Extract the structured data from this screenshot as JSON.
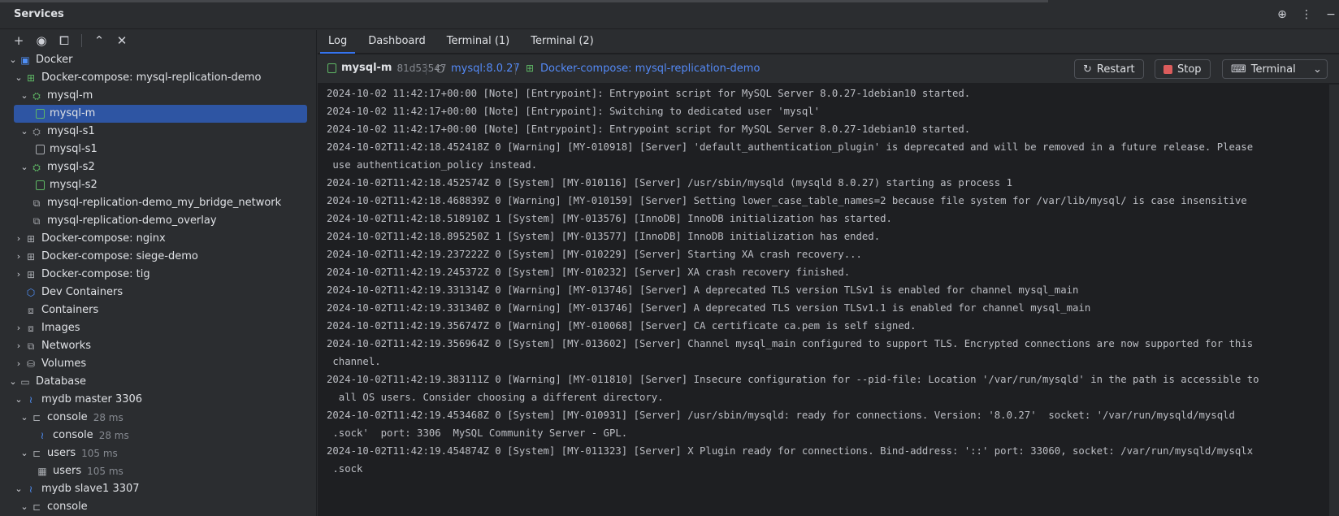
{
  "header": {
    "title": "Services"
  },
  "tree": [
    {
      "label": "Docker",
      "indent": 0,
      "chevron": "v",
      "icon": "docker-icon",
      "glyph": "▣",
      "cls": "docker",
      "meta": ""
    },
    {
      "label": "Docker-compose: mysql-replication-demo",
      "indent": 1,
      "chevron": "v",
      "icon": "compose-icon",
      "glyph": "⊞",
      "cls": "compose",
      "meta": ""
    },
    {
      "label": "mysql-m",
      "indent": 2,
      "chevron": "v",
      "icon": "service-icon",
      "glyph": "⛭",
      "cls": "svc",
      "meta": ""
    },
    {
      "label": "mysql-m",
      "indent": 3,
      "chevron": "",
      "icon": "container-running-icon",
      "glyph": "",
      "cls": "cont",
      "meta": "",
      "selected": true
    },
    {
      "label": "mysql-s1",
      "indent": 2,
      "chevron": "v",
      "icon": "service-icon",
      "glyph": "⛭",
      "cls": "svcg",
      "meta": ""
    },
    {
      "label": "mysql-s1",
      "indent": 3,
      "chevron": "",
      "icon": "container-stopped-icon",
      "glyph": "",
      "cls": "conto",
      "meta": ""
    },
    {
      "label": "mysql-s2",
      "indent": 2,
      "chevron": "v",
      "icon": "service-icon",
      "glyph": "⛭",
      "cls": "svc",
      "meta": ""
    },
    {
      "label": "mysql-s2",
      "indent": 3,
      "chevron": "",
      "icon": "container-running-icon",
      "glyph": "",
      "cls": "cont",
      "meta": ""
    },
    {
      "label": "mysql-replication-demo_my_bridge_network",
      "indent": 2,
      "chevron": "",
      "icon": "network-icon",
      "glyph": "⧉",
      "cls": "grey",
      "meta": ""
    },
    {
      "label": "mysql-replication-demo_overlay",
      "indent": 2,
      "chevron": "",
      "icon": "network-icon",
      "glyph": "⧉",
      "cls": "grey",
      "meta": ""
    },
    {
      "label": "Docker-compose: nginx",
      "indent": 1,
      "chevron": ">",
      "icon": "compose-icon",
      "glyph": "⊞",
      "cls": "grey",
      "meta": ""
    },
    {
      "label": "Docker-compose: siege-demo",
      "indent": 1,
      "chevron": ">",
      "icon": "compose-icon",
      "glyph": "⊞",
      "cls": "grey",
      "meta": ""
    },
    {
      "label": "Docker-compose: tig",
      "indent": 1,
      "chevron": ">",
      "icon": "compose-icon",
      "glyph": "⊞",
      "cls": "grey",
      "meta": ""
    },
    {
      "label": "Dev Containers",
      "indent": 1,
      "chevron": "",
      "icon": "dev-containers-icon",
      "glyph": "⬡",
      "cls": "blue",
      "meta": ""
    },
    {
      "label": "Containers",
      "indent": 1,
      "chevron": "",
      "icon": "containers-icon",
      "glyph": "⧈",
      "cls": "grey",
      "meta": ""
    },
    {
      "label": "Images",
      "indent": 1,
      "chevron": ">",
      "icon": "images-icon",
      "glyph": "⧈",
      "cls": "grey",
      "meta": ""
    },
    {
      "label": "Networks",
      "indent": 1,
      "chevron": ">",
      "icon": "networks-icon",
      "glyph": "⧉",
      "cls": "grey",
      "meta": ""
    },
    {
      "label": "Volumes",
      "indent": 1,
      "chevron": ">",
      "icon": "volumes-icon",
      "glyph": "⛁",
      "cls": "grey",
      "meta": ""
    },
    {
      "label": "Database",
      "indent": 0,
      "chevron": "v",
      "icon": "folder-icon",
      "glyph": "▭",
      "cls": "grey",
      "meta": ""
    },
    {
      "label": "mydb master 3306",
      "indent": 1,
      "chevron": "v",
      "icon": "mysql-icon",
      "glyph": "≀",
      "cls": "blue",
      "meta": ""
    },
    {
      "label": "console",
      "indent": 2,
      "chevron": "v",
      "icon": "console-icon",
      "glyph": "⊏",
      "cls": "grey",
      "meta": "28 ms"
    },
    {
      "label": "console",
      "indent": 3,
      "chevron": "",
      "icon": "mysql-icon",
      "glyph": "≀",
      "cls": "blue",
      "meta": "28 ms"
    },
    {
      "label": "users",
      "indent": 2,
      "chevron": "v",
      "icon": "console-icon",
      "glyph": "⊏",
      "cls": "grey",
      "meta": "105 ms"
    },
    {
      "label": "users",
      "indent": 3,
      "chevron": "",
      "icon": "table-icon",
      "glyph": "▦",
      "cls": "grey",
      "meta": "105 ms"
    },
    {
      "label": "mydb slave1 3307",
      "indent": 1,
      "chevron": "v",
      "icon": "mysql-icon",
      "glyph": "≀",
      "cls": "blue",
      "meta": ""
    },
    {
      "label": "console",
      "indent": 2,
      "chevron": "v",
      "icon": "console-icon",
      "glyph": "⊏",
      "cls": "grey",
      "meta": ""
    }
  ],
  "tabs": [
    "Log",
    "Dashboard",
    "Terminal (1)",
    "Terminal (2)"
  ],
  "info": {
    "container": "mysql-m",
    "hash": "81d53547",
    "image": "mysql:8.0.27",
    "compose": "Docker-compose: mysql-replication-demo"
  },
  "buttons": {
    "restart": "Restart",
    "stop": "Stop",
    "terminal": "Terminal"
  },
  "log": [
    "2024-10-02 11:42:17+00:00 [Note] [Entrypoint]: Entrypoint script for MySQL Server 8.0.27-1debian10 started.",
    "2024-10-02 11:42:17+00:00 [Note] [Entrypoint]: Switching to dedicated user 'mysql'",
    "2024-10-02 11:42:17+00:00 [Note] [Entrypoint]: Entrypoint script for MySQL Server 8.0.27-1debian10 started.",
    "2024-10-02T11:42:18.452418Z 0 [Warning] [MY-010918] [Server] 'default_authentication_plugin' is deprecated and will be removed in a future release. Please",
    " use authentication_policy instead.",
    "2024-10-02T11:42:18.452574Z 0 [System] [MY-010116] [Server] /usr/sbin/mysqld (mysqld 8.0.27) starting as process 1",
    "2024-10-02T11:42:18.468839Z 0 [Warning] [MY-010159] [Server] Setting lower_case_table_names=2 because file system for /var/lib/mysql/ is case insensitive",
    "2024-10-02T11:42:18.518910Z 1 [System] [MY-013576] [InnoDB] InnoDB initialization has started.",
    "2024-10-02T11:42:18.895250Z 1 [System] [MY-013577] [InnoDB] InnoDB initialization has ended.",
    "2024-10-02T11:42:19.237222Z 0 [System] [MY-010229] [Server] Starting XA crash recovery...",
    "2024-10-02T11:42:19.245372Z 0 [System] [MY-010232] [Server] XA crash recovery finished.",
    "2024-10-02T11:42:19.331314Z 0 [Warning] [MY-013746] [Server] A deprecated TLS version TLSv1 is enabled for channel mysql_main",
    "2024-10-02T11:42:19.331340Z 0 [Warning] [MY-013746] [Server] A deprecated TLS version TLSv1.1 is enabled for channel mysql_main",
    "2024-10-02T11:42:19.356747Z 0 [Warning] [MY-010068] [Server] CA certificate ca.pem is self signed.",
    "2024-10-02T11:42:19.356964Z 0 [System] [MY-013602] [Server] Channel mysql_main configured to support TLS. Encrypted connections are now supported for this",
    " channel.",
    "2024-10-02T11:42:19.383111Z 0 [Warning] [MY-011810] [Server] Insecure configuration for --pid-file: Location '/var/run/mysqld' in the path is accessible to",
    "  all OS users. Consider choosing a different directory.",
    "2024-10-02T11:42:19.453468Z 0 [System] [MY-010931] [Server] /usr/sbin/mysqld: ready for connections. Version: '8.0.27'  socket: '/var/run/mysqld/mysqld",
    " .sock'  port: 3306  MySQL Community Server - GPL.",
    "2024-10-02T11:42:19.454874Z 0 [System] [MY-011323] [Server] X Plugin ready for connections. Bind-address: '::' port: 33060, socket: /var/run/mysqld/mysqlx",
    " .sock"
  ]
}
